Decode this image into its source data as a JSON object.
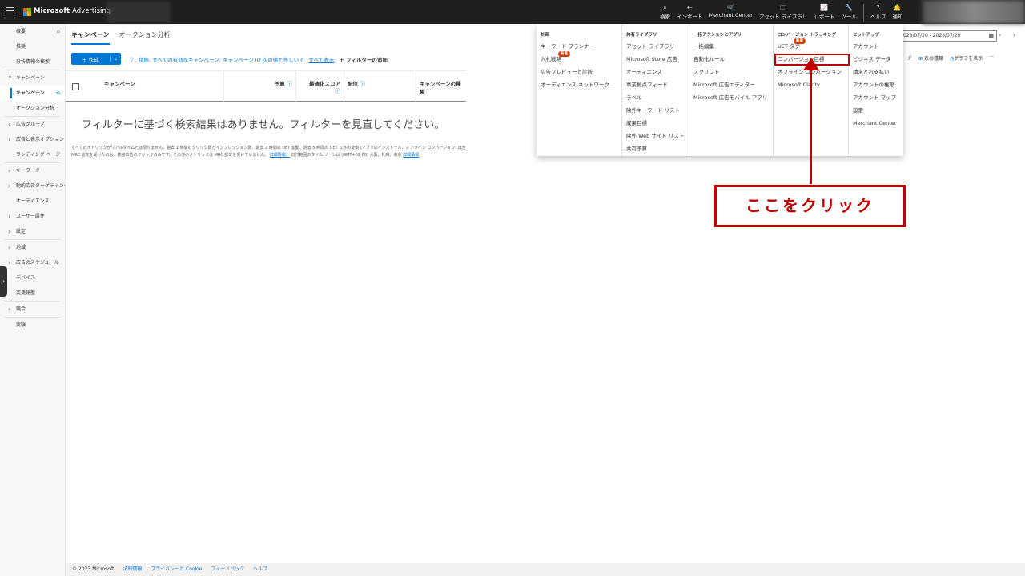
{
  "topbar": {
    "brand": "Microsoft",
    "product": "Advertising",
    "actions": [
      {
        "icon": "search-icon",
        "glyph": "⌕",
        "label": "検索"
      },
      {
        "icon": "import-icon",
        "glyph": "⇠",
        "label": "インポート"
      },
      {
        "icon": "cart-icon",
        "glyph": "🛒",
        "label": "Merchant Center"
      },
      {
        "icon": "library-icon",
        "glyph": "🗀",
        "label": "アセット ライブラリ"
      },
      {
        "icon": "chart-icon",
        "glyph": "📈",
        "label": "レポート"
      },
      {
        "icon": "wrench-icon",
        "glyph": "🔧",
        "label": "ツール"
      },
      {
        "icon": "help-icon",
        "glyph": "?",
        "label": "ヘルプ"
      },
      {
        "icon": "bell-icon",
        "glyph": "🔔",
        "label": "通知"
      }
    ]
  },
  "leftnav": {
    "items": [
      {
        "label": "概要",
        "kind": "plain"
      },
      {
        "label": "推奨",
        "kind": "plain"
      },
      {
        "label": "分析情報の検索",
        "kind": "plain"
      },
      {
        "label": "キャンペーン",
        "kind": "open"
      },
      {
        "label": "キャンペーン",
        "kind": "active"
      },
      {
        "label": "オークション分析",
        "kind": "sub"
      },
      {
        "label": "広告グループ",
        "kind": "caret"
      },
      {
        "label": "広告と表示オプション",
        "kind": "caret"
      },
      {
        "label": "ランディング ページ",
        "kind": "sub"
      },
      {
        "label": "キーワード",
        "kind": "caret"
      },
      {
        "label": "動的広告ターゲティング",
        "kind": "caret"
      },
      {
        "label": "オーディエンス",
        "kind": "sub"
      },
      {
        "label": "ユーザー属性",
        "kind": "caret"
      },
      {
        "label": "設定",
        "kind": "caret"
      },
      {
        "label": "地域",
        "kind": "caret"
      },
      {
        "label": "広告のスケジュール",
        "kind": "caret"
      },
      {
        "label": "デバイス",
        "kind": "sub"
      },
      {
        "label": "変更履歴",
        "kind": "plain"
      },
      {
        "label": "競合",
        "kind": "caret"
      },
      {
        "label": "実験",
        "kind": "plain"
      }
    ]
  },
  "main": {
    "tabs": [
      "キャンペーン",
      "オークション分析"
    ],
    "create_label": "＋ 作成",
    "filter": {
      "status": "状態: すべての有効なキャンペーン; キャンペーン ID 次の値と等しい 0",
      "show_all": "すべて表示",
      "add": "＋ フィルターの追加"
    },
    "columns": {
      "campaign": "キャンペーン",
      "budget": "予算",
      "opt_score": "最適化スコア",
      "delivery": "配信",
      "type": "キャンペーンの種類"
    },
    "empty_message": "フィルターに基づく検索結果はありません。フィルターを見直してください。",
    "note_line1": "すべてのメトリックがリアルタイムとは限りません。過去 1 時間のクリック数とインプレッション数、過去 2 時間の UET 変動、過去 5 時間の UET 以外の変動 (アプリのインストール、オフライン コンバージョン) は含",
    "note_line2_a": "MRC 認定を受けたのは、検索広告のクリックのみです。その他のメトリックは MRC 認定を受けていません。",
    "note_link1": "詳細情報。",
    "note_line2_b": "日付範囲のタイム ゾーンは (GMT+09:00) 大阪、札幌、東京",
    "note_link2": "詳細情報"
  },
  "right": {
    "daterange": "023/07/20 - 2023/07/20",
    "tools": [
      "ード",
      "表の種類",
      "グラフを表示",
      "···"
    ]
  },
  "mega_menu": {
    "columns": [
      {
        "header": "計画",
        "items": [
          "キーワード プランナー",
          "入札戦略",
          "広告プレビューと診断",
          "オーディエンス ネットワーク..."
        ]
      },
      {
        "header": "共有ライブラリ",
        "items": [
          "アセット ライブラリ",
          "Microsoft Store 広告",
          "オーディエンス",
          "事業拠点フィード",
          "ラベル",
          "除外キーワード リスト",
          "成果目標",
          "除外 Web サイト リスト",
          "共有予算"
        ]
      },
      {
        "header": "一括アクションとアプリ",
        "items": [
          "一括編集",
          "自動化ルール",
          "スクリプト",
          "Microsoft 広告エディター",
          "Microsoft 広告モバイル アプリ"
        ]
      },
      {
        "header": "コンバージョン トラッキング",
        "items": [
          "UET タグ",
          "コンバージョン目標",
          "オフライン コンバージョン",
          "Microsoft Clarity"
        ]
      },
      {
        "header": "セットアップ",
        "items": [
          "アカウント",
          "ビジネス データ",
          "請求とお支払い",
          "アカウントの権限",
          "アカウント マップ",
          "設定",
          "Merchant Center"
        ]
      }
    ],
    "badge_new": "新着"
  },
  "annotation": {
    "callout": "ここをクリック"
  },
  "footer": {
    "copyright": "© 2023 Microsoft",
    "links": [
      "法的情報",
      "プライバシーと Cookie",
      "フィードバック",
      "ヘルプ"
    ]
  },
  "colors": {
    "accent": "#0078d4",
    "annotation": "#c00000",
    "badge": "#d83b01"
  }
}
